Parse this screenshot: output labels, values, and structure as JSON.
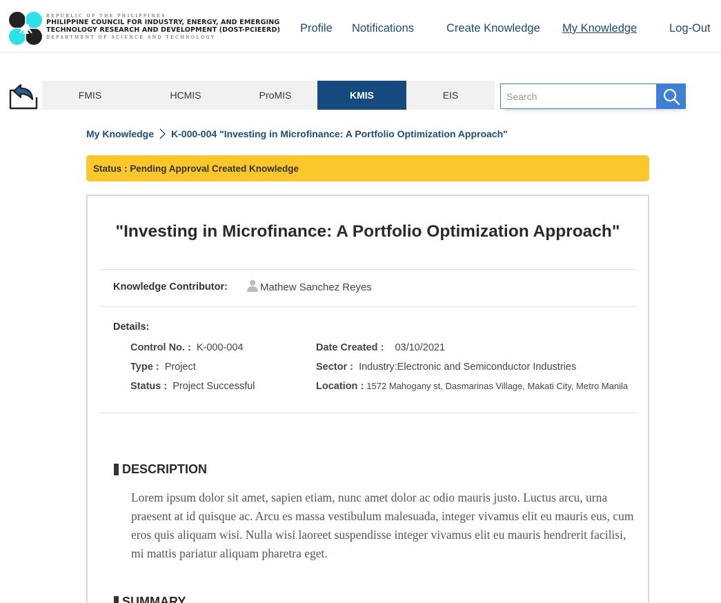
{
  "header": {
    "org_top": "REPUBLIC OF THE PHILIPPINES",
    "org_line1": "PHILIPPINE COUNCIL FOR INDUSTRY, ENERGY, AND EMERGING",
    "org_line2": "TECHNOLOGY RESEARCH AND DEVELOPMENT (DOST-PCIEERD)",
    "org_bottom": "DEPARTMENT OF SCIENCE AND TECHNOLOGY",
    "nav": {
      "profile": "Profile",
      "notifications": "Notifications",
      "create_knowledge": "Create Knowledge",
      "my_knowledge": "My Knowledge",
      "logout": "Log-Out"
    }
  },
  "tabs": {
    "fmis": "FMIS",
    "hcmis": "HCMIS",
    "promis": "ProMIS",
    "kmis": "KMIS",
    "eis": "EIS",
    "active": "KMIS"
  },
  "search": {
    "placeholder": "Search",
    "value": ""
  },
  "breadcrumb": {
    "root": "My Knowledge",
    "current": "K-000-004 \"Investing in Microfinance: A Portfolio Optimization Approach\""
  },
  "status_banner": "Status : Pending Approval Created Knowledge",
  "knowledge": {
    "title": "\"Investing in Microfinance: A Portfolio Optimization Approach\"",
    "contributor_label": "Knowledge Contributor:",
    "contributor_name": "Mathew Sanchez Reyes",
    "details_label": "Details:",
    "control_no_label": "Control No. :",
    "control_no": "K-000-004",
    "type_label": "Type :",
    "type": "Project",
    "status_label": "Status :",
    "status": "Project Successful",
    "date_created_label": "Date Created :",
    "date_created": "03/10/2021",
    "sector_label": "Sector :",
    "sector": "Industry:Electronic and Semiconductor Industries",
    "location_label": "Location :",
    "location": "1572 Mahogany st, Dasmarinas Village, Makati City, Metro Manila",
    "description_heading": "DESCRIPTION",
    "description": "Lorem ipsum dolor sit amet, sapien etiam, nunc amet dolor ac odio mauris justo. Luctus arcu, urna praesent at id quisque ac. Arcu es massa vestibulum malesuada, integer vivamus elit eu mauris eus, cum eros quis aliquam wisi. Nulla wisi laoreet suspendisse integer vivamus elit eu mauris hendrerit facilisi, mi mattis pariatur aliquam pharetra eget.",
    "summary_heading": "SUMMARY"
  },
  "colors": {
    "accent_blue": "#164a7e",
    "link_blue": "#1d4a77",
    "search_blue": "#3f7fd4",
    "status_yellow": "#fcc62d",
    "logo_cyan": "#2fe0e8"
  },
  "icons": [
    "pcieerd-logo-icon",
    "back-arrow-icon",
    "search-icon",
    "chevron-right-icon",
    "user-icon"
  ]
}
